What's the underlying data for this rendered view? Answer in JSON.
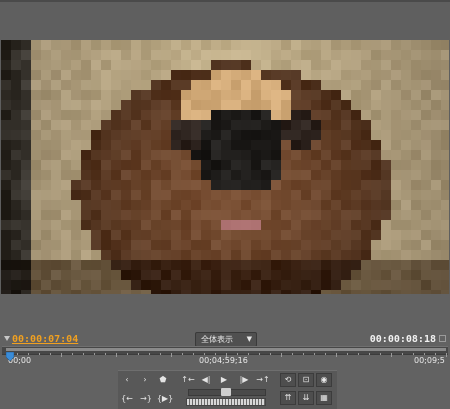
{
  "monitor": {
    "current_time": "00:00:07:04",
    "duration": "00:00:08:18",
    "view_mode": "全体表示"
  },
  "ruler": {
    "start_label": "00;00",
    "mid_label": "00;04;59;16",
    "end_label": "00;09;5"
  },
  "icons": {
    "step_back": "‹",
    "step_forward": "›",
    "marker": "⬟",
    "goto_in": "{←",
    "goto_out": "→}",
    "play_in_out": "{▶}",
    "prev_edit": "↑←",
    "frame_back": "◀|",
    "play": "▶",
    "frame_forward": "|▶",
    "next_edit": "→↑",
    "loop": "⟲",
    "safe_margins": "⊡",
    "output": "◉",
    "lift": "⇈",
    "extract": "⇊",
    "export_frame": "▦"
  }
}
